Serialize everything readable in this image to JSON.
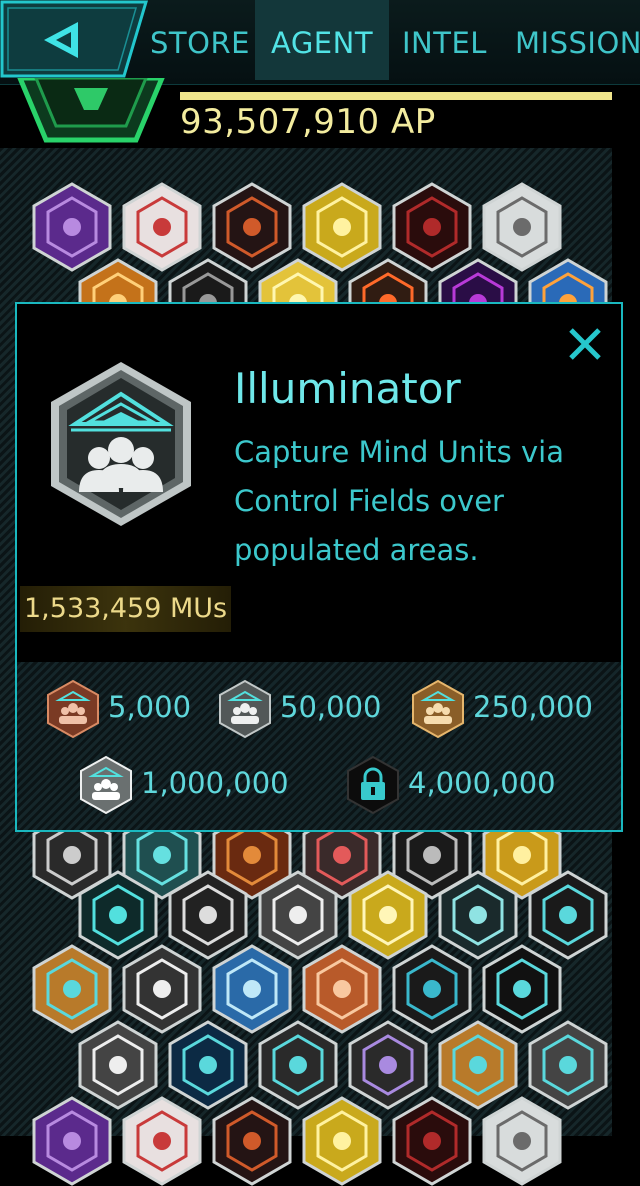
{
  "nav": {
    "tabs": [
      {
        "label": "STORE",
        "active": false
      },
      {
        "label": "AGENT",
        "active": true
      },
      {
        "label": "INTEL",
        "active": false
      },
      {
        "label": "MISSION",
        "active": false
      }
    ]
  },
  "profile": {
    "ap": "93,507,910 AP"
  },
  "medal_popup": {
    "title": "Illuminator",
    "description": "Capture Mind Units via Control Fields over populated areas.",
    "progress": "1,533,459 MUs",
    "tiers": [
      {
        "name": "bronze",
        "threshold": "5,000",
        "color": "#b86a45"
      },
      {
        "name": "silver",
        "threshold": "50,000",
        "color": "#a8b0b2"
      },
      {
        "name": "gold",
        "threshold": "250,000",
        "color": "#d9a85a"
      },
      {
        "name": "platinum",
        "threshold": "1,000,000",
        "color": "#d8dcdc"
      },
      {
        "name": "onyx",
        "threshold": "4,000,000",
        "color": "#1a1a1a",
        "locked": true
      }
    ]
  },
  "colors": {
    "accent": "#1ab8bf",
    "text_cyan": "#3cc8cc",
    "ap_yellow": "#f3ec9f"
  },
  "icons": {
    "back": "back-arrow-icon",
    "close": "close-icon",
    "locked": "lock-icon"
  }
}
